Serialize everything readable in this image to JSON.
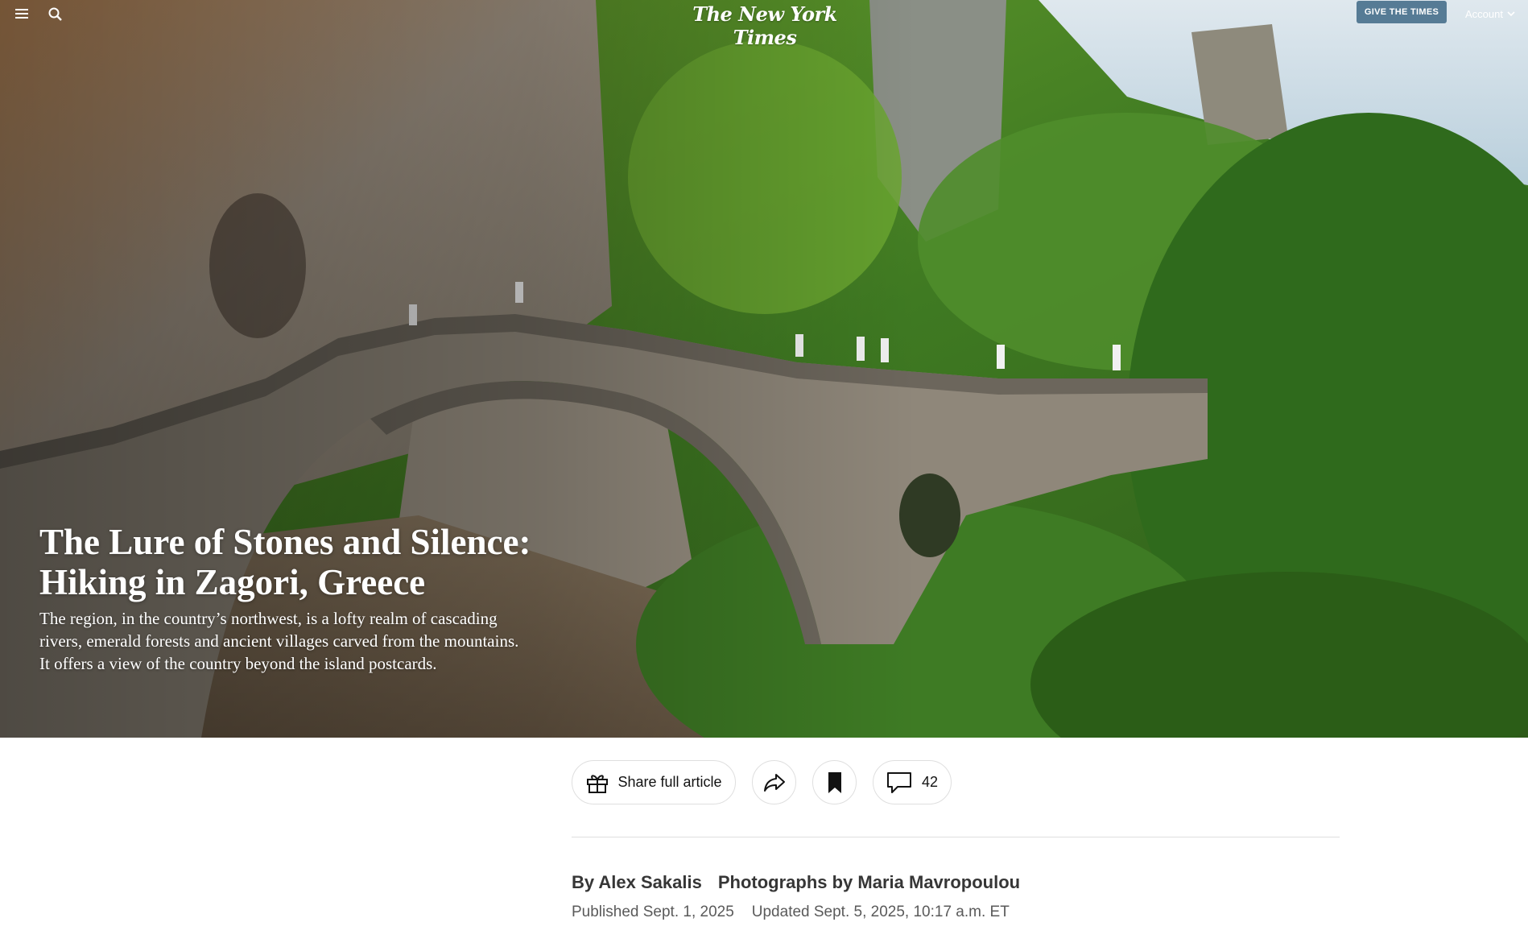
{
  "header": {
    "logo": "The New York Times",
    "give_button": "GIVE THE TIMES",
    "account_label": "Account",
    "menu_icon": "hamburger-menu-icon",
    "search_icon": "search-icon"
  },
  "article": {
    "headline_line1": "The Lure of Stones and Silence:",
    "headline_line2": "Hiking in Zagori, Greece",
    "dek": "The region, in the country’s northwest, is a lofty realm of cascading rivers, emerald forests and ancient villages carved from the mountains. It offers a view of the country beyond the island postcards.",
    "byline_author": "By Alex Sakalis",
    "byline_photos": "Photographs by Maria Mavropoulou",
    "published": "Published Sept. 1, 2025",
    "updated": "Updated Sept. 5, 2025, 10:17 a.m. ET"
  },
  "toolbar": {
    "share_full_label": "Share full article",
    "share_icon": "share-arrow-icon",
    "gift_icon": "gift-icon",
    "bookmark_icon": "bookmark-icon",
    "comment_icon": "comment-icon",
    "comment_count": "42"
  },
  "colors": {
    "give_button_bg": "#567b95",
    "text_primary": "#121212"
  }
}
